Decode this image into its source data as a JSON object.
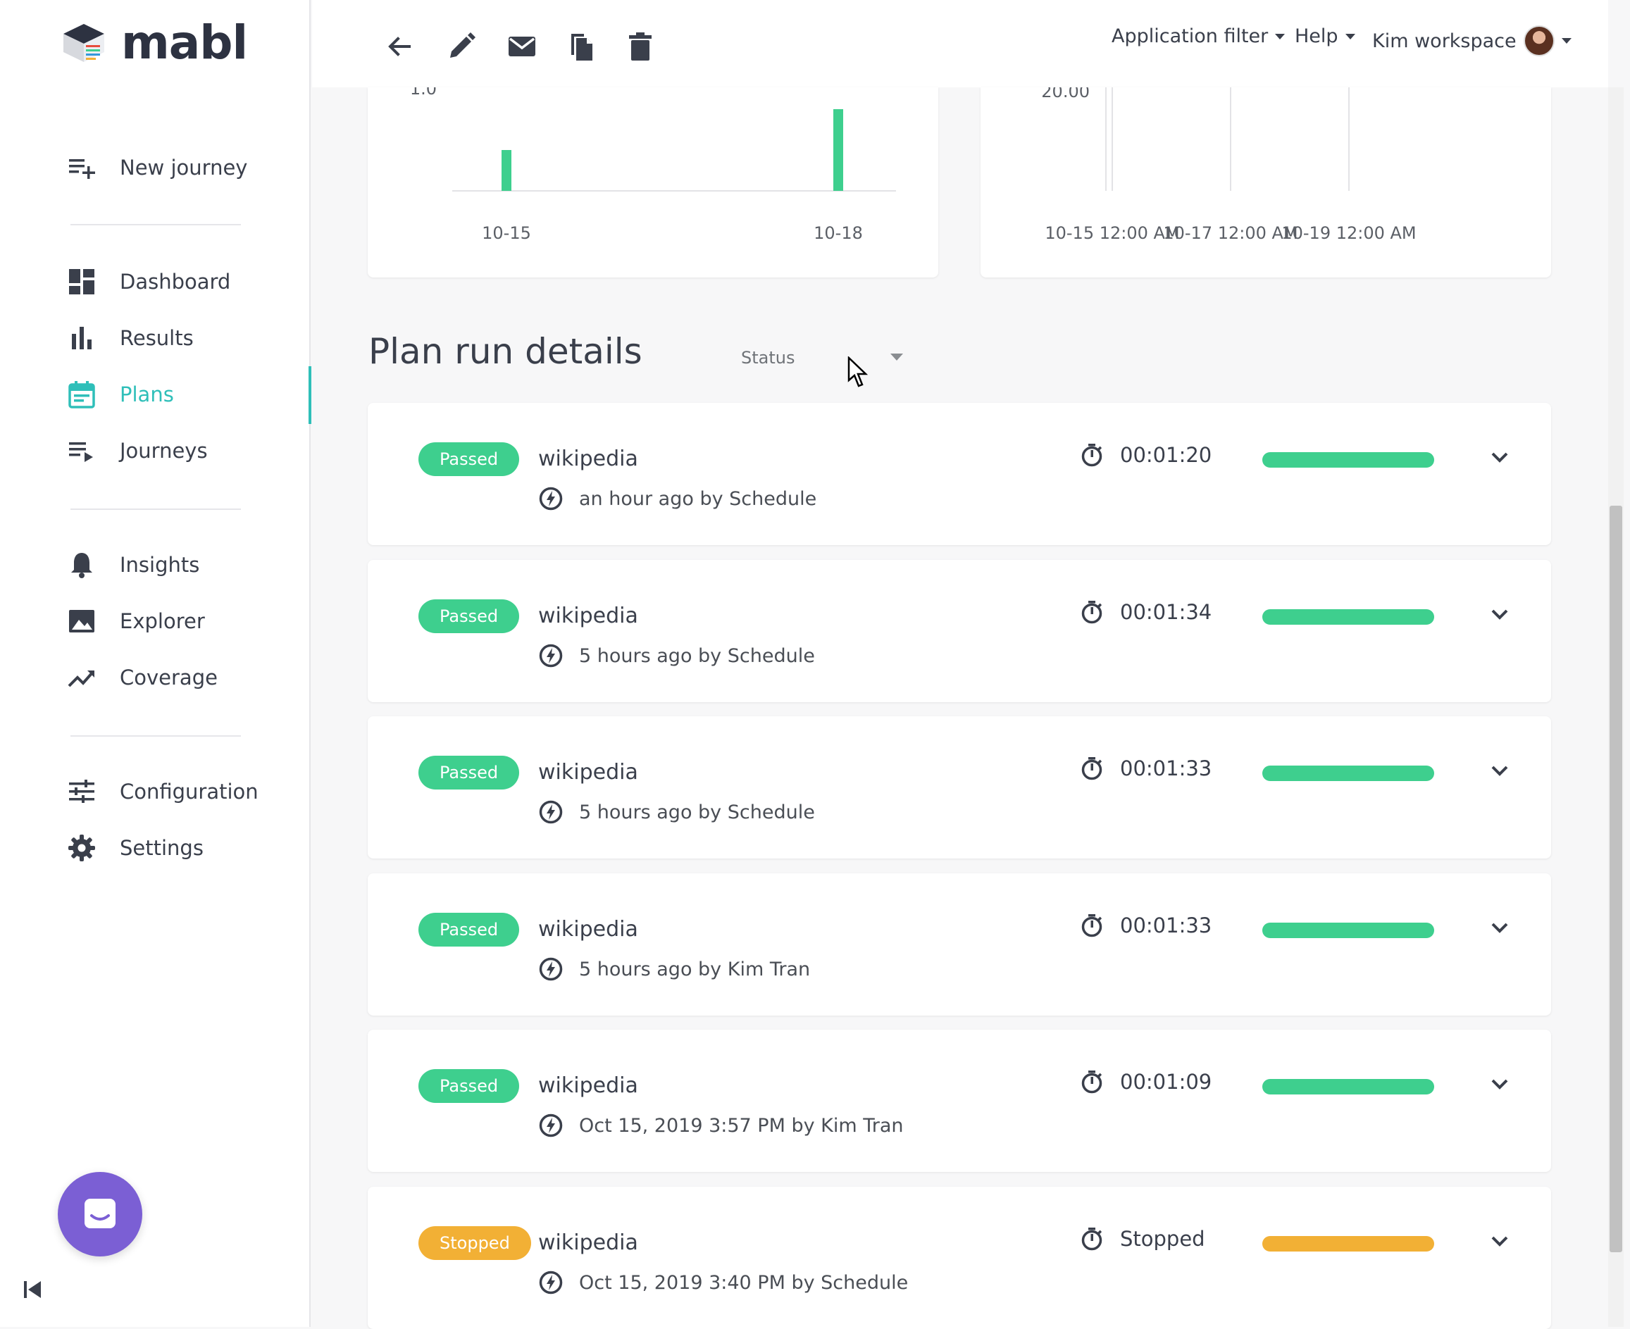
{
  "app": {
    "logo_text": "mabl"
  },
  "sidebar": {
    "new_journey": "New journey",
    "items": [
      {
        "label": "Dashboard",
        "icon": "dashboard-icon"
      },
      {
        "label": "Results",
        "icon": "bar-chart-icon"
      },
      {
        "label": "Plans",
        "icon": "calendar-icon",
        "active": true
      },
      {
        "label": "Journeys",
        "icon": "playlist-icon"
      },
      {
        "label": "Insights",
        "icon": "bell-icon"
      },
      {
        "label": "Explorer",
        "icon": "image-icon"
      },
      {
        "label": "Coverage",
        "icon": "trending-up-icon"
      },
      {
        "label": "Configuration",
        "icon": "sliders-icon"
      },
      {
        "label": "Settings",
        "icon": "gear-icon"
      }
    ]
  },
  "topbar": {
    "application_filter": "Application filter",
    "help": "Help",
    "workspace": "Kim workspace"
  },
  "chart_data": [
    {
      "type": "bar",
      "categories": [
        "10-15",
        "10-18"
      ],
      "values": [
        1.0,
        2.0
      ],
      "y_tick_labels": [
        "1.0"
      ]
    },
    {
      "type": "line",
      "x_tick_labels": [
        "10-15 12:00 AM",
        "10-17 12:00 AM",
        "10-19 12:00 AM"
      ],
      "y_tick_labels": [
        "20.00"
      ]
    }
  ],
  "plan_run_details": {
    "title": "Plan run details",
    "status_filter_label": "Status",
    "runs": [
      {
        "status": "Passed",
        "name": "wikipedia",
        "meta": "an hour ago by Schedule",
        "duration": "00:01:20",
        "progress": 1.0
      },
      {
        "status": "Passed",
        "name": "wikipedia",
        "meta": "5 hours ago by Schedule",
        "duration": "00:01:34",
        "progress": 1.0
      },
      {
        "status": "Passed",
        "name": "wikipedia",
        "meta": "5 hours ago by Schedule",
        "duration": "00:01:33",
        "progress": 1.0
      },
      {
        "status": "Passed",
        "name": "wikipedia",
        "meta": "5 hours ago by Kim Tran",
        "duration": "00:01:33",
        "progress": 1.0
      },
      {
        "status": "Passed",
        "name": "wikipedia",
        "meta": "Oct 15, 2019 3:57 PM by Kim Tran",
        "duration": "00:01:09",
        "progress": 1.0
      },
      {
        "status": "Stopped",
        "name": "wikipedia",
        "meta": "Oct 15, 2019 3:40 PM by Schedule",
        "duration": "Stopped",
        "progress": 1.0
      }
    ]
  },
  "colors": {
    "accent": "#2fbfb9",
    "passed": "#3ecf8e",
    "stopped": "#f2b035",
    "chat": "#7b5fd4"
  }
}
